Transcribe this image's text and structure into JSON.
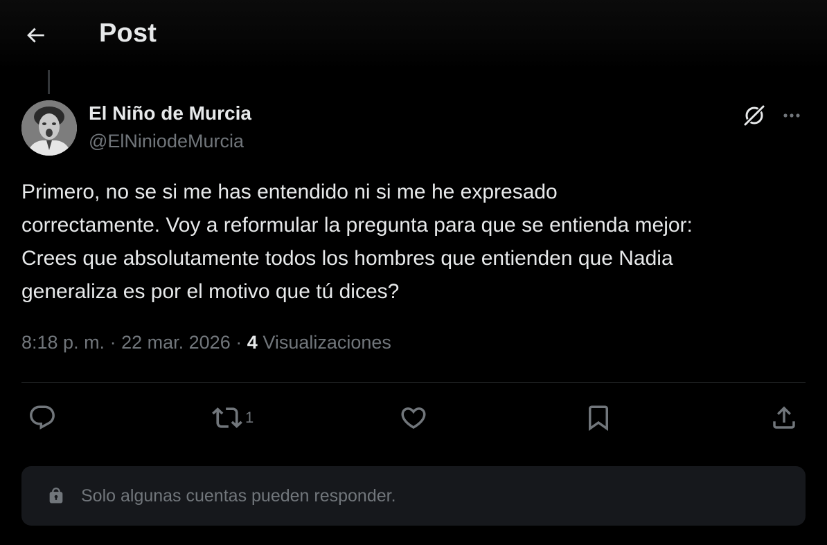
{
  "header": {
    "title": "Post",
    "back_icon": "arrow-left-icon"
  },
  "post": {
    "author": {
      "name": "El Niño de Murcia",
      "handle": "@ElNiniodeMurcia"
    },
    "text": "Primero, no se si me has entendido ni si me he expresado\ncorrectamente. Voy a reformular la pregunta para que se entienda mejor:\nCrees que absolutamente todos los hombres que entienden que Nadia\ngeneraliza es por el motivo que tú dices?",
    "time": "8:18 p. m.",
    "separator": "·",
    "date": "22 mar. 2026",
    "views_count": "4",
    "views_label": "Visualizaciones"
  },
  "actions": {
    "reply": {
      "icon": "reply-bubble-icon"
    },
    "repost": {
      "icon": "repost-icon",
      "count": "1"
    },
    "like": {
      "icon": "heart-icon"
    },
    "bookmark": {
      "icon": "bookmark-icon"
    },
    "share": {
      "icon": "share-icon"
    }
  },
  "reply_restriction": {
    "icon": "lock-icon",
    "text": "Solo algunas cuentas pueden responder."
  },
  "colors": {
    "background": "#000000",
    "primary_text": "#e7e9ea",
    "secondary_text": "#71767b",
    "divider": "#2f3336",
    "panel": "#16181c"
  }
}
